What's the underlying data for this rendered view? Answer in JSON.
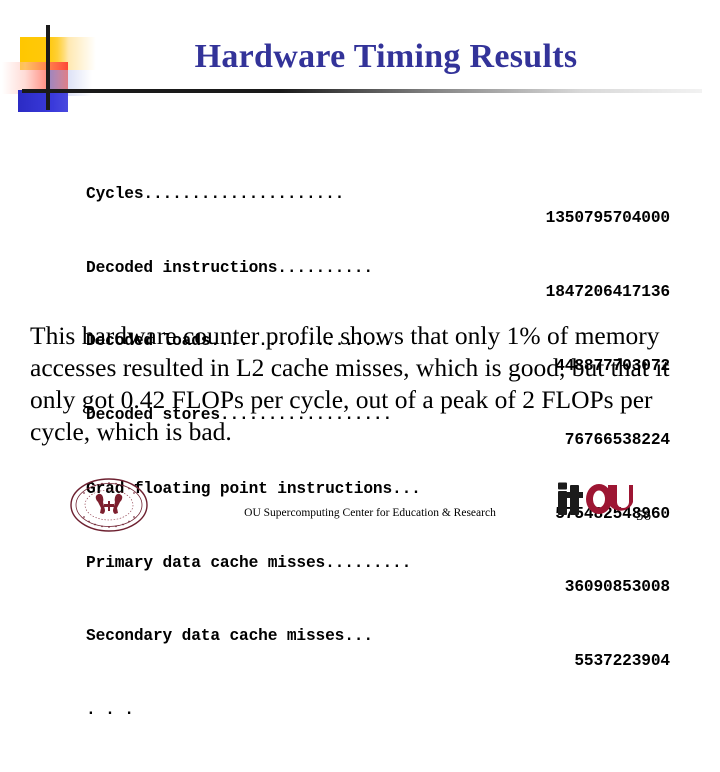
{
  "slide": {
    "title": "Hardware Timing Results",
    "title_color": "#333399",
    "page_number": "56"
  },
  "logo_decoration": {
    "name": "powerpoint-corner-logo",
    "colors": {
      "yellow": "#FFC700",
      "red": "#FF4733",
      "blue": "#2B2BC4",
      "bar": "#1a1a1a"
    }
  },
  "listing": {
    "rows": [
      {
        "label": "Cycles.....................",
        "value": "1350795704000"
      },
      {
        "label": "Decoded instructions..........",
        "value": "1847206417136"
      },
      {
        "label": "Decoded loads...................",
        "value": "448877703072"
      },
      {
        "label": "Decoded stores..................",
        "value": "76766538224"
      },
      {
        "label": "Grad floating point instructions...",
        "value": "575482548960"
      },
      {
        "label": "Primary data cache misses.........",
        "value": "36090853008"
      },
      {
        "label": "Secondary data cache misses...",
        "value": "5537223904"
      },
      {
        "label": ". . .",
        "value": ""
      }
    ]
  },
  "body": {
    "paragraph": "This hardware counter profile shows that only 1% of memory accesses resulted in L2 cache misses, which is good, but that it only got 0.42 FLOPs per cycle, out of a peak of 2 FLOPs per cycle, which is bad."
  },
  "footer": {
    "organization": "OU Supercomputing Center for Education & Research",
    "seal_label": "ou-university-seal",
    "itou_logo": {
      "it_text": "it",
      "ou_text": "OU",
      "it_color": "#1b1b1b",
      "ou_color": "#9d1633"
    }
  }
}
